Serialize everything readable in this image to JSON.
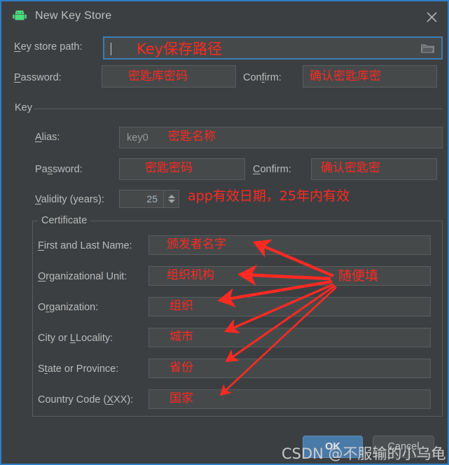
{
  "window": {
    "title": "New Key Store",
    "app_icon": "android-robot-icon",
    "close_icon": "close-icon",
    "accent_color": "#2f7ec4",
    "background_color": "#3c3f41",
    "annotation_color": "#ff2a22"
  },
  "keystore": {
    "path_label": "Key store path:",
    "path_value": "",
    "path_annotation": "Key保存路径",
    "browse_icon": "folder-icon",
    "password_label": "Password:",
    "password_annotation": "密匙库密码",
    "confirm_label": "Confirm:",
    "confirm_annotation": "确认密匙库密"
  },
  "key_group": {
    "title": "Key",
    "alias_label": "Alias:",
    "alias_value": "key0",
    "alias_annotation": "密匙名称",
    "password_label": "Password:",
    "password_annotation": "密匙密码",
    "confirm_label": "Confirm:",
    "confirm_annotation": "确认密匙密",
    "validity_label": "Validity (years):",
    "validity_value": "25",
    "validity_annotation": "app有效日期，25年内有效"
  },
  "certificate": {
    "title": "Certificate",
    "shared_annotation": "随便填",
    "fields": [
      {
        "label": "First and Last Name:",
        "value": "",
        "annotation": "颁发者名字"
      },
      {
        "label": "Organizational Unit:",
        "value": "",
        "annotation": "组织机构"
      },
      {
        "label": "Organization:",
        "value": "",
        "annotation": "组织"
      },
      {
        "label": "City or Locality:",
        "value": "",
        "annotation": "城市"
      },
      {
        "label": "State or Province:",
        "value": "",
        "annotation": "省份"
      },
      {
        "label": "Country Code (XX):",
        "value": "",
        "annotation": "国家"
      }
    ]
  },
  "buttons": {
    "ok": "OK",
    "cancel": "Cancel"
  },
  "watermark": "CSDN @不服输的小乌龟"
}
